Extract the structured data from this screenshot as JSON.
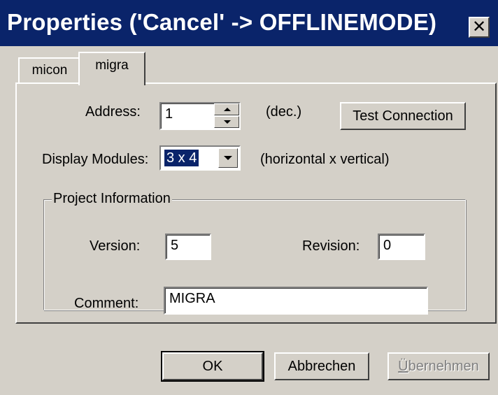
{
  "window": {
    "title": "Properties ('Cancel' -> OFFLINEMODE)",
    "close_icon": "close-icon",
    "colors": {
      "title_bar": "#0a246a",
      "face": "#d4d0c8"
    }
  },
  "tabs": [
    {
      "label": "micon",
      "selected": false
    },
    {
      "label": "migra",
      "selected": true
    }
  ],
  "form": {
    "address_label": "Address:",
    "address_value": "1",
    "address_unit": "(dec.)",
    "test_connection_label": "Test Connection",
    "display_modules_label": "Display Modules:",
    "display_modules_value": "3 x 4",
    "display_modules_hint": "(horizontal x vertical)"
  },
  "project_info": {
    "group_label": "Project Information",
    "version_label": "Version:",
    "version_value": "5",
    "revision_label": "Revision:",
    "revision_value": "0",
    "comment_label": "Comment:",
    "comment_value": "MIGRA"
  },
  "buttons": {
    "ok": "OK",
    "cancel": "Abbrechen",
    "apply_accel": "Ü",
    "apply_rest": "bernehmen",
    "apply_enabled": false
  }
}
